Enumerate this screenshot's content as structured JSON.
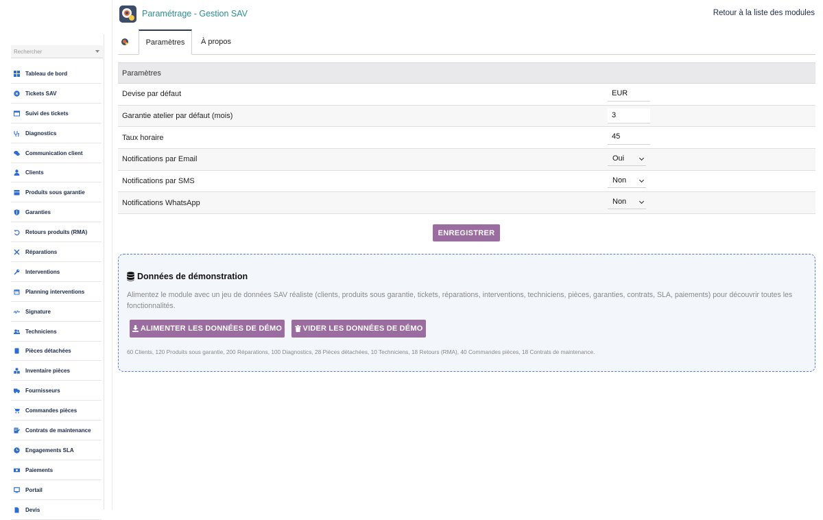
{
  "sidebar": {
    "search_placeholder": "Rechercher",
    "items": [
      {
        "label": "Tableau de bord",
        "icon": "dashboard-icon"
      },
      {
        "label": "Tickets SAV",
        "icon": "ticket-icon"
      },
      {
        "label": "Suivi des tickets",
        "icon": "list-icon"
      },
      {
        "label": "Diagnostics",
        "icon": "stethoscope-icon"
      },
      {
        "label": "Communication client",
        "icon": "chat-icon"
      },
      {
        "label": "Clients",
        "icon": "user-icon"
      },
      {
        "label": "Produits sous garantie",
        "icon": "box-icon"
      },
      {
        "label": "Garanties",
        "icon": "shield-icon"
      },
      {
        "label": "Retours produits (RMA)",
        "icon": "undo-icon"
      },
      {
        "label": "Réparations",
        "icon": "tools-icon"
      },
      {
        "label": "Interventions",
        "icon": "wrench-icon"
      },
      {
        "label": "Planning interventions",
        "icon": "calendar-icon"
      },
      {
        "label": "Signature",
        "icon": "signature-icon"
      },
      {
        "label": "Techniciens",
        "icon": "users-icon"
      },
      {
        "label": "Pièces détachées",
        "icon": "book-icon"
      },
      {
        "label": "Inventaire pièces",
        "icon": "boxes-icon"
      },
      {
        "label": "Fournisseurs",
        "icon": "truck-icon"
      },
      {
        "label": "Commandes pièces",
        "icon": "cart-icon"
      },
      {
        "label": "Contrats de maintenance",
        "icon": "contract-icon"
      },
      {
        "label": "Engagements SLA",
        "icon": "clock-icon"
      },
      {
        "label": "Paiements",
        "icon": "money-icon"
      },
      {
        "label": "Portail",
        "icon": "monitor-icon"
      },
      {
        "label": "Devis",
        "icon": "file-icon"
      }
    ]
  },
  "header": {
    "title": "Paramétrage - Gestion SAV",
    "back_link": "Retour à la liste des modules"
  },
  "tabs": [
    {
      "label": "Paramètres",
      "active": true
    },
    {
      "label": "À propos",
      "active": false
    }
  ],
  "params": {
    "section_title": "Paramètres",
    "rows": [
      {
        "label": "Devise par défaut",
        "value": "EUR",
        "kind": "input"
      },
      {
        "label": "Garantie atelier par défaut (mois)",
        "value": "3",
        "kind": "input"
      },
      {
        "label": "Taux horaire",
        "value": "45",
        "kind": "input"
      },
      {
        "label": "Notifications par Email",
        "value": "Oui",
        "kind": "select"
      },
      {
        "label": "Notifications par SMS",
        "value": "Non",
        "kind": "select"
      },
      {
        "label": "Notifications WhatsApp",
        "value": "Non",
        "kind": "select"
      }
    ],
    "save_label": "ENREGISTRER"
  },
  "demo": {
    "title": "Données de démonstration",
    "description": "Alimentez le module avec un jeu de données SAV réaliste (clients, produits sous garantie, tickets, réparations, interventions, techniciens, pièces, garanties, contrats, SLA, paiements) pour découvrir toutes les fonctionnalités.",
    "fill_label": "ALIMENTER LES DONNÉES DE DÉMO",
    "empty_label": "VIDER LES DONNÉES DE DÉMO",
    "stats": "60 Clients, 120 Produits sous garantie, 200 Réparations, 100 Diagnostics, 28 Pièces détachées, 10 Techniciens, 18 Retours (RMA), 40 Commandes pièces, 18 Contrats de maintenance."
  },
  "colors": {
    "accent_button": "#9b6c9f",
    "title_teal": "#2a8f8f",
    "icon_blue": "#2d6bd6",
    "demo_border": "#4f7fd1"
  }
}
